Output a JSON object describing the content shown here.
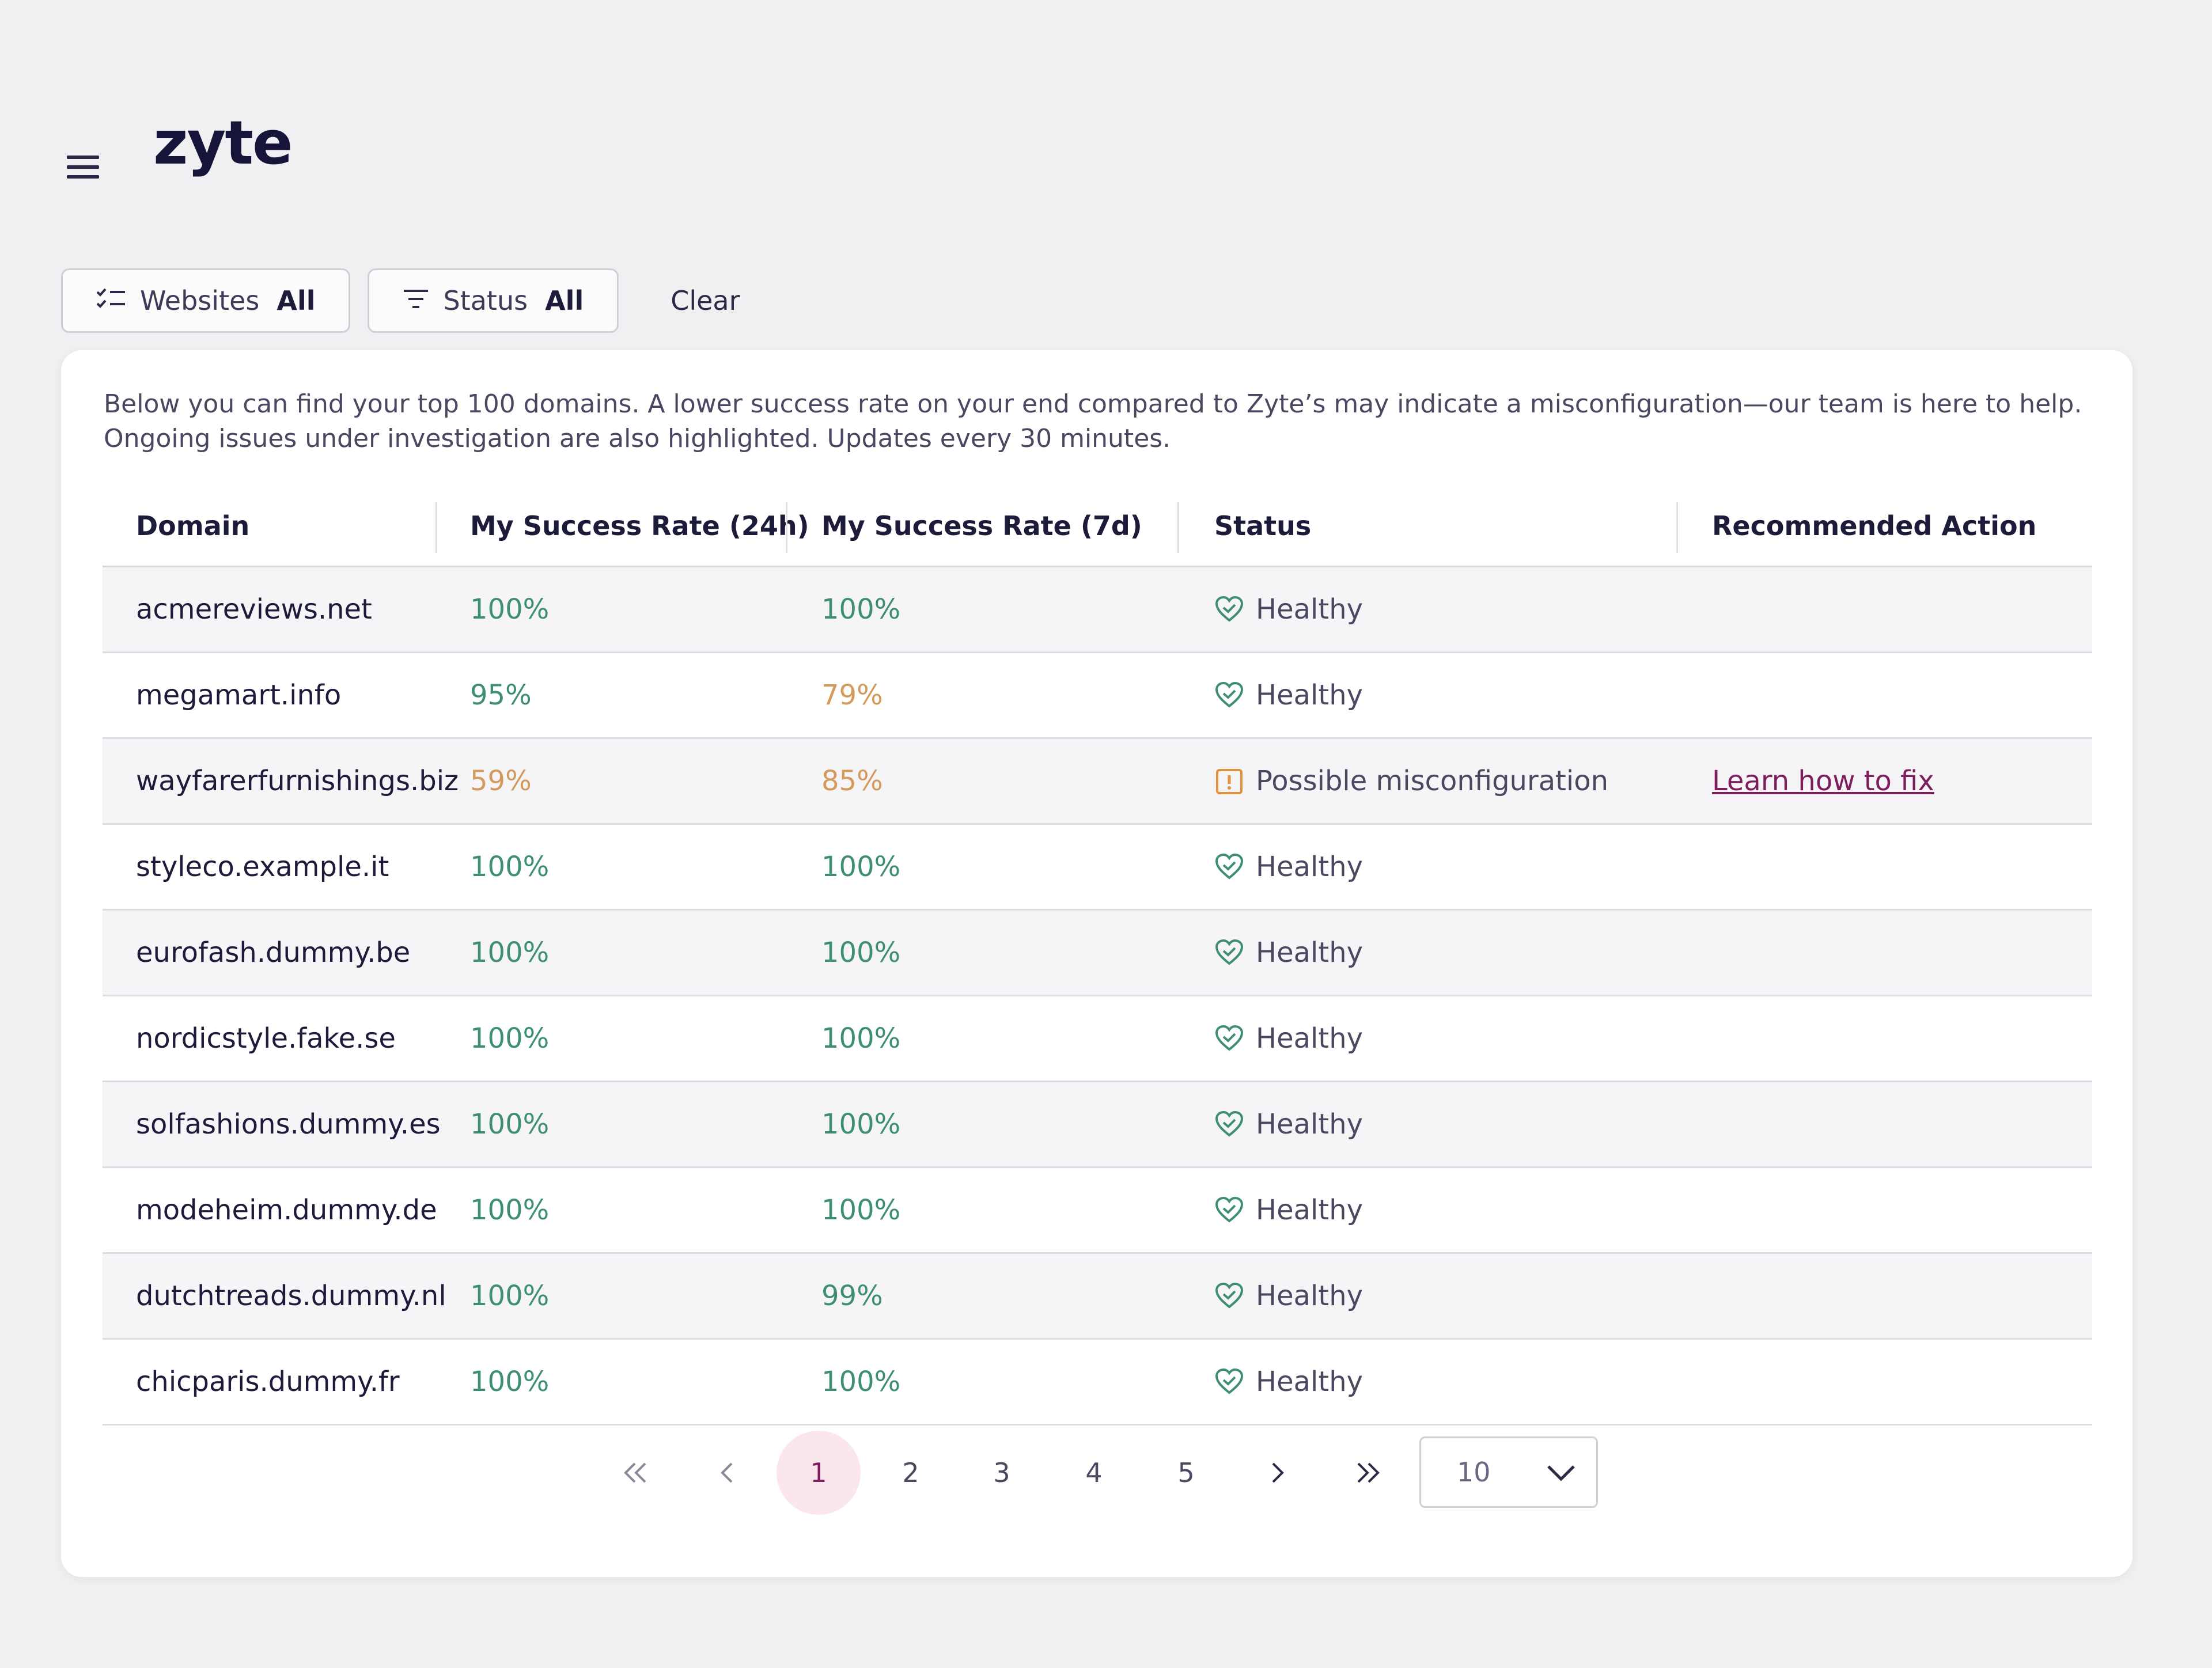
{
  "header": {
    "logo_text": "zyte",
    "menu_icon": "hamburger-menu-icon"
  },
  "filters": {
    "websites": {
      "label": "Websites",
      "value": "All",
      "icon": "checklist-icon"
    },
    "status": {
      "label": "Status",
      "value": "All",
      "icon": "filter-icon"
    },
    "clear_label": "Clear"
  },
  "description": "Below you can find your top 100 domains. A lower success rate on your end compared to Zyte’s may indicate a misconfiguration—our team is here to help. Ongoing issues under investigation are also highlighted. Updates every 30 minutes.",
  "table": {
    "columns": [
      "Domain",
      "My Success Rate (24h)",
      "My Success Rate (7d)",
      "Status",
      "Recommended Action"
    ],
    "rows": [
      {
        "domain": "acmereviews.net",
        "rate_24h": "100%",
        "rate_7d": "100%",
        "status": "Healthy",
        "action": ""
      },
      {
        "domain": "megamart.info",
        "rate_24h": "95%",
        "rate_7d": "79%",
        "status": "Healthy",
        "action": ""
      },
      {
        "domain": "wayfarerfurnishings.biz",
        "rate_24h": "59%",
        "rate_7d": "85%",
        "status": "Possible misconfiguration",
        "action": "Learn how to fix"
      },
      {
        "domain": "styleco.example.it",
        "rate_24h": "100%",
        "rate_7d": "100%",
        "status": "Healthy",
        "action": ""
      },
      {
        "domain": "eurofash.dummy.be",
        "rate_24h": "100%",
        "rate_7d": "100%",
        "status": "Healthy",
        "action": ""
      },
      {
        "domain": "nordicstyle.fake.se",
        "rate_24h": "100%",
        "rate_7d": "100%",
        "status": "Healthy",
        "action": ""
      },
      {
        "domain": "solfashions.dummy.es",
        "rate_24h": "100%",
        "rate_7d": "100%",
        "status": "Healthy",
        "action": ""
      },
      {
        "domain": "modeheim.dummy.de",
        "rate_24h": "100%",
        "rate_7d": "100%",
        "status": "Healthy",
        "action": ""
      },
      {
        "domain": "dutchtreads.dummy.nl",
        "rate_24h": "100%",
        "rate_7d": "99%",
        "status": "Healthy",
        "action": ""
      },
      {
        "domain": "chicparis.dummy.fr",
        "rate_24h": "100%",
        "rate_7d": "100%",
        "status": "Healthy",
        "action": ""
      }
    ]
  },
  "pagination": {
    "pages": [
      "1",
      "2",
      "3",
      "4",
      "5"
    ],
    "current_page": "1",
    "page_size": "10"
  },
  "colors": {
    "rate_good": "#3e8e72",
    "rate_warn": "#d49a5c",
    "healthy_icon": "#3e8e72",
    "warning_icon": "#e0913a",
    "link": "#7d1d5c",
    "active_page_bg": "#fbe6ee"
  }
}
